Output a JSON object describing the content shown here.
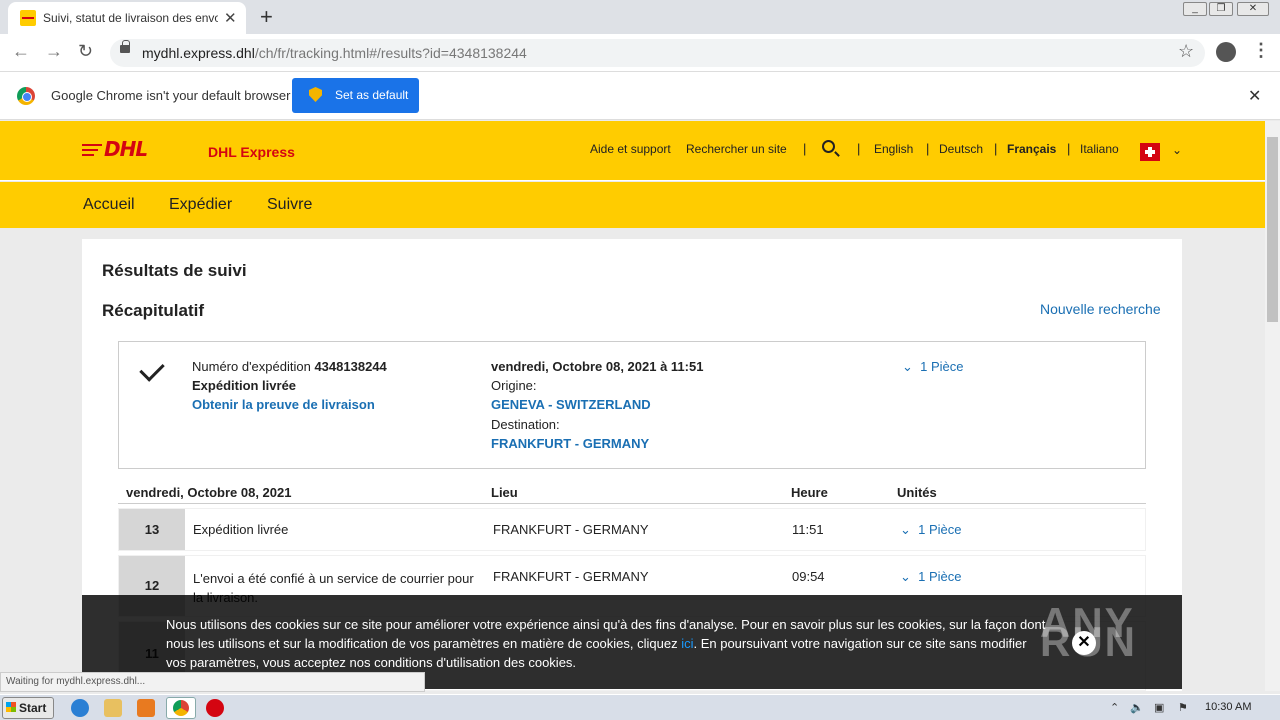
{
  "browser": {
    "tab_title": "Suivi, statut de livraison des envois D",
    "tab_close": "✕",
    "new_tab": "+",
    "url_host": "mydhl.express.dhl",
    "url_path": "/ch/fr/tracking.html#/results?id=4348138244",
    "infobar_text": "Google Chrome isn't your default browser",
    "set_default_label": "Set as default",
    "status_text": "Waiting for mydhl.express.dhl..."
  },
  "header": {
    "logo_text": "DHL",
    "brand": "DHL Express",
    "links": [
      "Aide et support",
      "Rechercher un site"
    ],
    "languages": [
      "English",
      "Deutsch",
      "Français",
      "Italiano"
    ],
    "active_language": "Français"
  },
  "nav": [
    "Accueil",
    "Expédier",
    "Suivre"
  ],
  "results": {
    "title": "Résultats de suivi",
    "summary_title": "Récapitulatif",
    "new_search": "Nouvelle recherche",
    "shipment_label": "Numéro d'expédition",
    "shipment_number": "4348138244",
    "status": "Expédition livrée",
    "proof_link": "Obtenir la preuve de livraison",
    "datetime": "vendredi, Octobre 08, 2021 à 11:51",
    "origin_label": "Origine:",
    "origin": "GENEVA - SWITZERLAND",
    "destination_label": "Destination:",
    "destination": "FRANKFURT - GERMANY",
    "pieces": "1 Pièce"
  },
  "events": {
    "date": "vendredi, Octobre 08, 2021",
    "col_location": "Lieu",
    "col_time": "Heure",
    "col_units": "Unités",
    "rows": [
      {
        "num": "13",
        "desc": "Expédition livrée",
        "location": "FRANKFURT - GERMANY",
        "time": "11:51",
        "units": "1 Pièce"
      },
      {
        "num": "12",
        "desc": "L'envoi a été confié à un service de courrier pour la livraison.",
        "location": "FRANKFURT - GERMANY",
        "time": "09:54",
        "units": "1 Pièce"
      },
      {
        "num": "11"
      }
    ]
  },
  "cookie": {
    "text_before": "Nous utilisons des cookies sur ce site pour améliorer votre expérience ainsi qu'à des fins d'analyse. Pour en savoir plus sur les cookies, sur la façon dont nous les utilisons et sur la modification de vos paramètres en matière de cookies, cliquez ",
    "link": "ici",
    "text_after": ". En poursuivant votre navigation sur ce site sans modifier vos paramètres, vous acceptez nos conditions d'utilisation des cookies.",
    "close": "✕",
    "watermark": "ANY RUN"
  },
  "taskbar": {
    "start": "Start",
    "clock": "10:30 AM"
  }
}
